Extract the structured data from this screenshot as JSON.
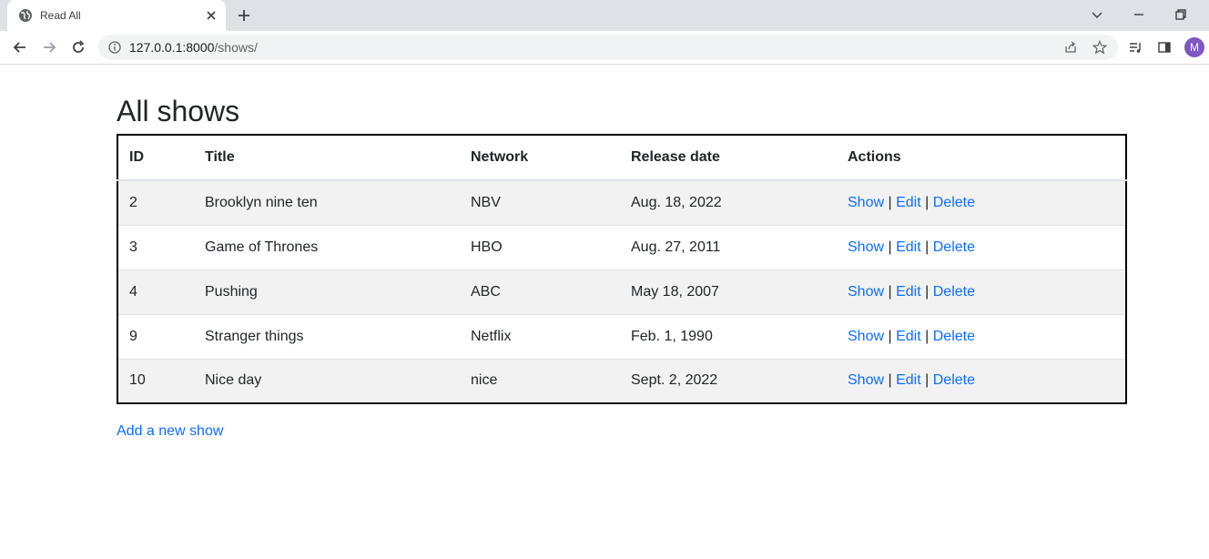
{
  "browser": {
    "tab_title": "Read All",
    "url_host": "127.0.0.1:8000",
    "url_path": "/shows/",
    "profile_initial": "M",
    "avatar_color": "#7e57c2",
    "icons": [
      "globe-icon",
      "close-icon",
      "plus-icon",
      "chevron-down-icon",
      "minimize-icon",
      "restore-icon",
      "back-icon",
      "forward-icon",
      "reload-icon",
      "info-icon",
      "share-icon",
      "star-icon",
      "reading-list-icon",
      "side-panel-icon"
    ]
  },
  "page": {
    "title": "All shows",
    "columns": {
      "id": "ID",
      "title": "Title",
      "network": "Network",
      "release_date": "Release date",
      "actions": "Actions"
    },
    "rows": [
      {
        "id": "2",
        "title": "Brooklyn nine ten",
        "network": "NBV",
        "release_date": "Aug. 18, 2022"
      },
      {
        "id": "3",
        "title": "Game of Thrones",
        "network": "HBO",
        "release_date": "Aug. 27, 2011"
      },
      {
        "id": "4",
        "title": "Pushing",
        "network": "ABC",
        "release_date": "May 18, 2007"
      },
      {
        "id": "9",
        "title": "Stranger things",
        "network": "Netflix",
        "release_date": "Feb. 1, 1990"
      },
      {
        "id": "10",
        "title": "Nice day",
        "network": "nice",
        "release_date": "Sept. 2, 2022"
      }
    ],
    "actions": {
      "show": "Show",
      "edit": "Edit",
      "delete": "Delete",
      "separator": "|"
    },
    "add_link": "Add a new show",
    "link_color": "#0d6efd",
    "stripe_color": "#f2f2f2"
  }
}
